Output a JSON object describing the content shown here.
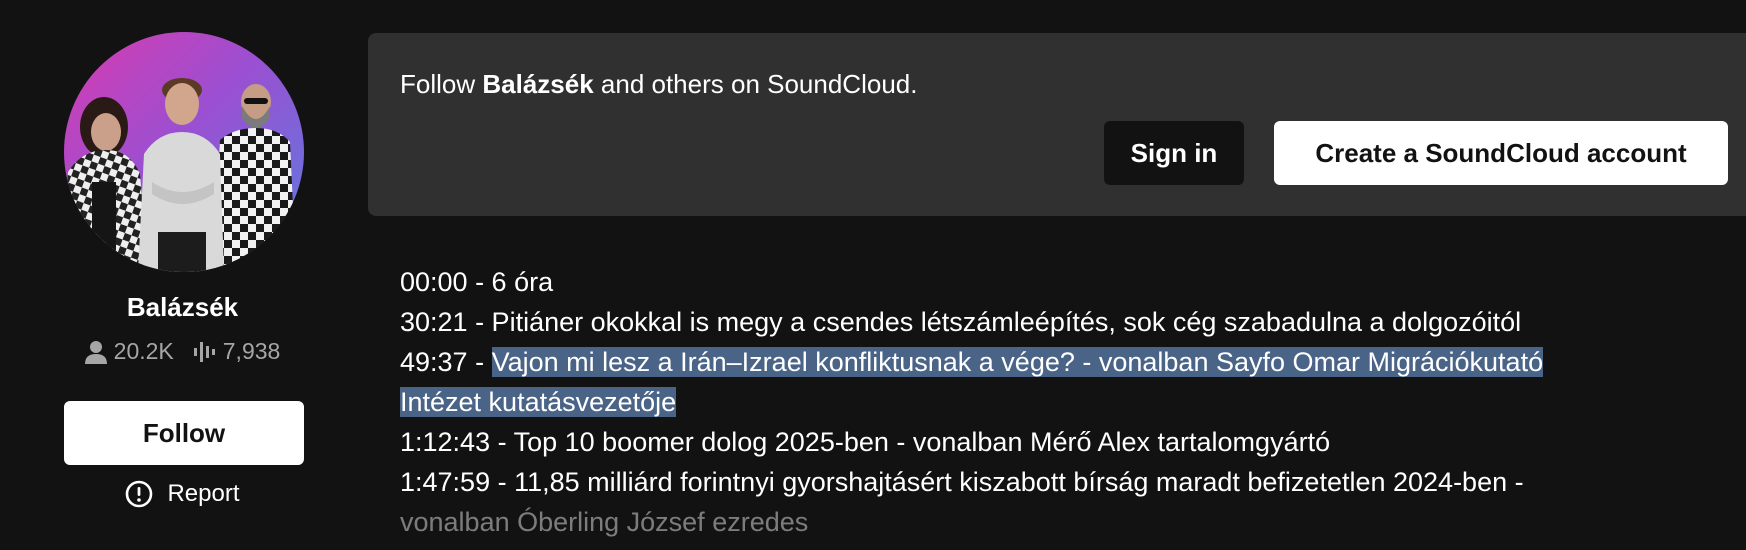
{
  "profile": {
    "name": "Balázsék",
    "followers": "20.2K",
    "tracks": "7,938",
    "follow_label": "Follow",
    "report_label": "Report"
  },
  "banner": {
    "prefix": "Follow ",
    "name": "Balázsék",
    "suffix": " and others on SoundCloud.",
    "signin_label": "Sign in",
    "create_label": "Create a SoundCloud account"
  },
  "description": {
    "line1": "00:00 - 6 óra",
    "line2": "30:21 - Pitiáner okokkal is megy a csendes létszámleépítés, sok cég szabadulna a dolgozóitól",
    "line3_time": "49:37 - ",
    "line3_selected_a": "Vajon mi lesz a Irán–Izrael konfliktusnak a vége? - vonalban Sayfo Omar Migrációkutató",
    "line3_selected_b": "Intézet kutatásvezetője",
    "line4": "1:12:43 - Top 10 boomer dolog 2025-ben - vonalban Mérő Alex tartalomgyártó",
    "line5": "1:47:59 - 11,85 milliárd forintnyi gyorshajtásért kiszabott bírság maradt befizetetlen 2024-ben -",
    "line6": "vonalban Óberling József ezredes"
  },
  "colors": {
    "background": "#121212",
    "banner": "#303030",
    "selection": "#4a6487",
    "muted": "#a6a6a6"
  },
  "icons": {
    "followers": "user-icon",
    "tracks": "waveform-icon",
    "report": "alert-circle-icon"
  }
}
